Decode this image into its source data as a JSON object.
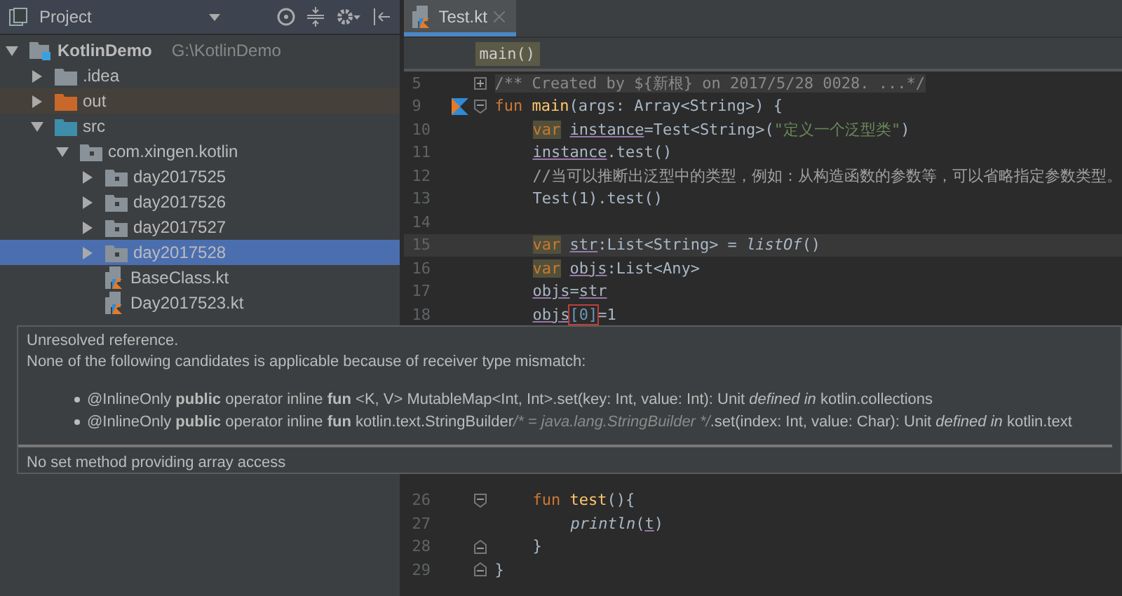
{
  "project_panel": {
    "title": "Project",
    "tree": [
      {
        "label": "KotlinDemo",
        "path": "G:\\KotlinDemo",
        "kind": "module",
        "expanded": true,
        "selected": false,
        "children": [
          {
            "label": ".idea",
            "kind": "folder",
            "expanded": false,
            "selected": false
          },
          {
            "label": "out",
            "kind": "excluded-folder",
            "expanded": false,
            "selected": false
          },
          {
            "label": "src",
            "kind": "source-folder",
            "expanded": true,
            "selected": false,
            "children": [
              {
                "label": "com.xingen.kotlin",
                "kind": "package",
                "expanded": true,
                "selected": false,
                "children": [
                  {
                    "label": "day2017525",
                    "kind": "package",
                    "expanded": false,
                    "selected": false
                  },
                  {
                    "label": "day2017526",
                    "kind": "package",
                    "expanded": false,
                    "selected": false
                  },
                  {
                    "label": "day2017527",
                    "kind": "package",
                    "expanded": false,
                    "selected": false
                  },
                  {
                    "label": "day2017528",
                    "kind": "package",
                    "expanded": false,
                    "selected": true
                  },
                  {
                    "label": "BaseClass.kt",
                    "kind": "kotlin-file",
                    "selected": false
                  },
                  {
                    "label": "Day2017523.kt",
                    "kind": "kotlin-file",
                    "selected": false
                  }
                ]
              }
            ]
          }
        ]
      }
    ]
  },
  "editor": {
    "tabs": [
      {
        "label": "Test.kt",
        "selected": true
      }
    ],
    "breadcrumb": "main()",
    "lines_top": [
      {
        "number": "5",
        "kind": "fold-collapsed",
        "run_marker": false,
        "current": false,
        "segments": [
          {
            "text": "/** Created by ${新根} on 2017/5/28 0028. ...*/",
            "kind": "folded"
          }
        ]
      },
      {
        "number": "9",
        "kind": "fold-start",
        "run_marker": true,
        "current": false,
        "segments": [
          {
            "text": "fun",
            "kind": "keyword"
          },
          {
            "text": "main",
            "kind": "function"
          },
          {
            "text": "(args: Array<String>) {",
            "kind": "plain"
          }
        ]
      },
      {
        "number": "10",
        "kind": "line",
        "run_marker": false,
        "current": false,
        "segments": [
          {
            "text": "var",
            "kind": "var"
          },
          {
            "text": "instance",
            "kind": "reference"
          },
          {
            "text": "=Test<String>(",
            "kind": "plain"
          },
          {
            "text": "\"定义一个泛型类\"",
            "kind": "string"
          },
          {
            "text": ")",
            "kind": "plain"
          }
        ]
      },
      {
        "number": "11",
        "kind": "line",
        "run_marker": false,
        "current": false,
        "segments": [
          {
            "text": "instance",
            "kind": "reference"
          },
          {
            "text": ".test()",
            "kind": "plain"
          }
        ]
      },
      {
        "number": "12",
        "kind": "line",
        "run_marker": false,
        "current": false,
        "segments": [
          {
            "text": "//当可以推断出泛型中的类型，例如：从构造函数的参数等，可以省略指定参数类型。",
            "kind": "comment"
          }
        ]
      },
      {
        "number": "13",
        "kind": "line",
        "run_marker": false,
        "current": false,
        "segments": [
          {
            "text": "Test(1).test()",
            "kind": "plain"
          }
        ]
      },
      {
        "number": "14",
        "kind": "line",
        "run_marker": false,
        "current": false
      },
      {
        "number": "15",
        "kind": "line",
        "run_marker": false,
        "current": true,
        "segments": [
          {
            "text": "var",
            "kind": "var"
          },
          {
            "text": "str",
            "kind": "reference"
          },
          {
            "text": ":List<String> = ",
            "kind": "plain"
          },
          {
            "text": "listOf",
            "kind": "italic"
          },
          {
            "text": "()",
            "kind": "plain"
          }
        ]
      },
      {
        "number": "16",
        "kind": "line",
        "run_marker": false,
        "current": false,
        "segments": [
          {
            "text": "var",
            "kind": "var"
          },
          {
            "text": "objs",
            "kind": "reference"
          },
          {
            "text": ":List<Any>",
            "kind": "plain"
          }
        ]
      },
      {
        "number": "17",
        "kind": "line",
        "run_marker": false,
        "current": false,
        "segments": [
          {
            "text": "objs",
            "kind": "reference"
          },
          {
            "text": "=",
            "kind": "plain"
          },
          {
            "text": "str",
            "kind": "reference"
          }
        ]
      },
      {
        "number": "18",
        "kind": "line",
        "run_marker": false,
        "current": false,
        "segments": [
          {
            "text": "objs",
            "kind": "reference"
          },
          {
            "text": "[0]",
            "kind": "error"
          },
          {
            "text": "=1",
            "kind": "plain"
          }
        ]
      }
    ],
    "lines_bottom": [
      {
        "number": "26",
        "kind": "fold-start",
        "run_marker": false,
        "current": false,
        "segments": [
          {
            "text": "fun",
            "kind": "keyword"
          },
          {
            "text": "test",
            "kind": "function"
          },
          {
            "text": "(){",
            "kind": "plain"
          }
        ]
      },
      {
        "number": "27",
        "kind": "line",
        "run_marker": false,
        "current": false,
        "segments": [
          {
            "text": "println",
            "kind": "italic"
          },
          {
            "text": "(",
            "kind": "plain"
          },
          {
            "text": "t",
            "kind": "reference"
          },
          {
            "text": ")",
            "kind": "plain"
          }
        ]
      },
      {
        "number": "28",
        "kind": "fold-end",
        "run_marker": false,
        "current": false,
        "segments": [
          {
            "text": "}",
            "kind": "plain"
          }
        ]
      },
      {
        "number": "29",
        "kind": "fold-end",
        "run_marker": false,
        "current": false,
        "segments": [
          {
            "text": "}",
            "kind": "plain"
          }
        ]
      }
    ]
  },
  "error_tooltip": {
    "title": "Unresolved reference.",
    "message": "None of the following candidates is applicable because of receiver type mismatch:",
    "candidates": [
      {
        "signature": "@InlineOnly **public** operator inline **fun** <K, V> MutableMap<Int, Int>.set(key: Int, value: Int): Unit *defined in* kotlin.collections"
      },
      {
        "signature": "@InlineOnly **public** operator inline **fun** kotlin.text.StringBuilder",
        "type_comment": "/* = java.lang.StringBuilder */",
        "suffix": ".set(index: Int, value: Char): Unit *defined in* kotlin.text"
      }
    ],
    "footer": "No set method providing array access"
  }
}
